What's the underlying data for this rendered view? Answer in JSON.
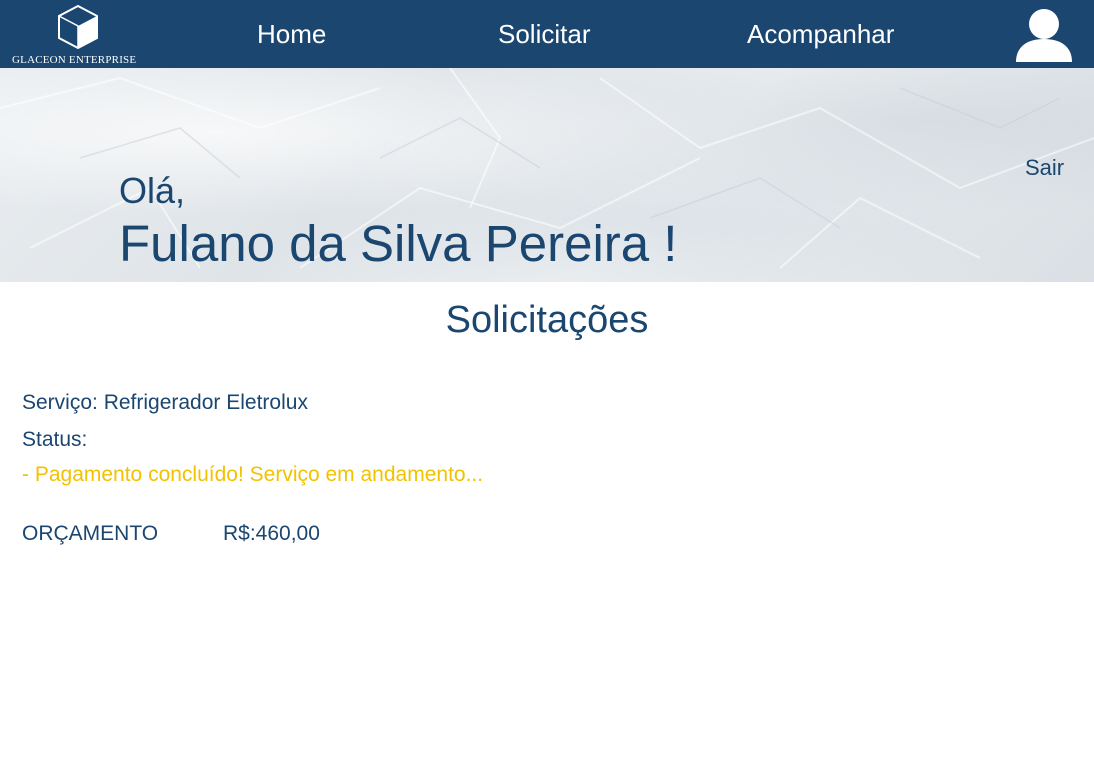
{
  "brand": {
    "name": "GLACEON ENTERPRISE",
    "logo_icon": "cube-icon",
    "primary_color": "#1a4670",
    "status_color": "#f2c200"
  },
  "nav": {
    "home": "Home",
    "request": "Solicitar",
    "track": "Acompanhar",
    "avatar_icon": "user-icon"
  },
  "hero": {
    "greeting": "Olá,",
    "user_name": "Fulano da Silva Pereira !",
    "logout": "Sair"
  },
  "requests": {
    "title": "Solicitações",
    "service": "Serviço: Refrigerador Eletrolux",
    "status_label": "Status:",
    "status_value": "- Pagamento concluído! Serviço em andamento...",
    "budget_label": "ORÇAMENTO",
    "budget_value": "R$:460,00"
  }
}
